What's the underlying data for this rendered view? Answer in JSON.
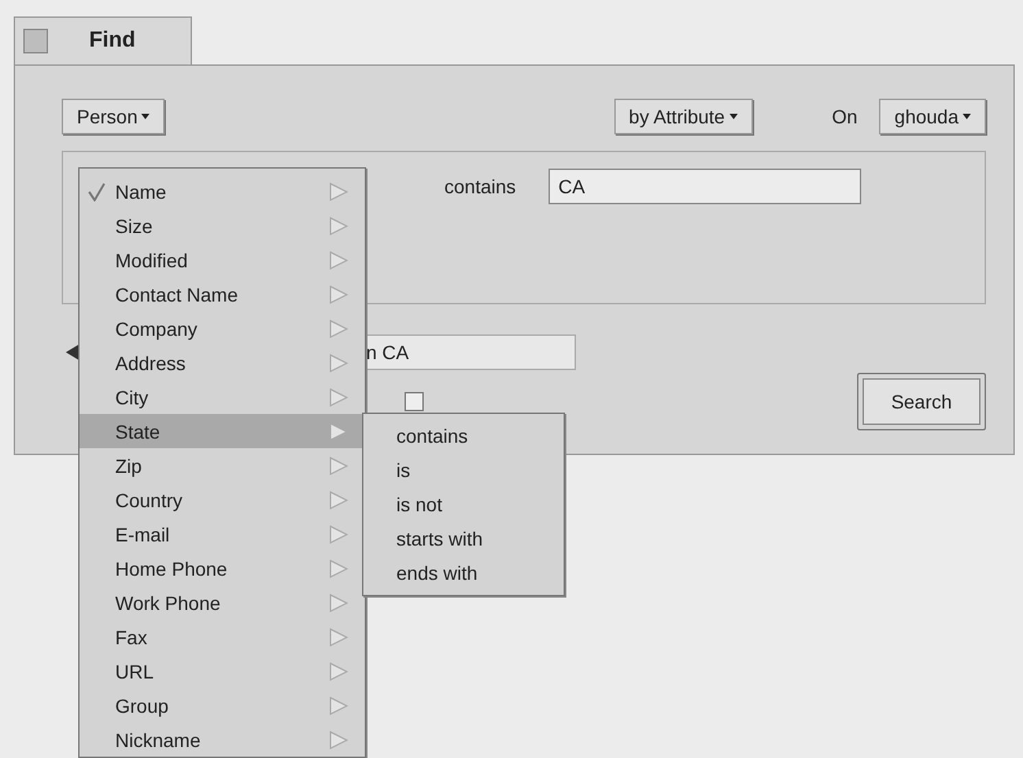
{
  "window": {
    "tab": {
      "label": "Find"
    }
  },
  "type_menu": {
    "label": "Person"
  },
  "method_menu": {
    "label": "by Attribute"
  },
  "volume": {
    "label": "On",
    "menu": "ghouda"
  },
  "query": {
    "operator": "contains",
    "value": "CA"
  },
  "summary": {
    "expanded": false,
    "value": "n CA"
  },
  "option": {
    "checked": false
  },
  "search_button": "Search",
  "attribute_menu": [
    {
      "label": "Name",
      "checked": true,
      "selected": false
    },
    {
      "label": "Size",
      "checked": false,
      "selected": false
    },
    {
      "label": "Modified",
      "checked": false,
      "selected": false
    },
    {
      "label": "Contact Name",
      "checked": false,
      "selected": false
    },
    {
      "label": "Company",
      "checked": false,
      "selected": false
    },
    {
      "label": "Address",
      "checked": false,
      "selected": false
    },
    {
      "label": "City",
      "checked": false,
      "selected": false
    },
    {
      "label": "State",
      "checked": false,
      "selected": true
    },
    {
      "label": "Zip",
      "checked": false,
      "selected": false
    },
    {
      "label": "Country",
      "checked": false,
      "selected": false
    },
    {
      "label": "E-mail",
      "checked": false,
      "selected": false
    },
    {
      "label": "Home Phone",
      "checked": false,
      "selected": false
    },
    {
      "label": "Work Phone",
      "checked": false,
      "selected": false
    },
    {
      "label": "Fax",
      "checked": false,
      "selected": false
    },
    {
      "label": "URL",
      "checked": false,
      "selected": false
    },
    {
      "label": "Group",
      "checked": false,
      "selected": false
    },
    {
      "label": "Nickname",
      "checked": false,
      "selected": false
    }
  ],
  "operator_menu": [
    "contains",
    "is",
    "is not",
    "starts with",
    "ends with"
  ]
}
